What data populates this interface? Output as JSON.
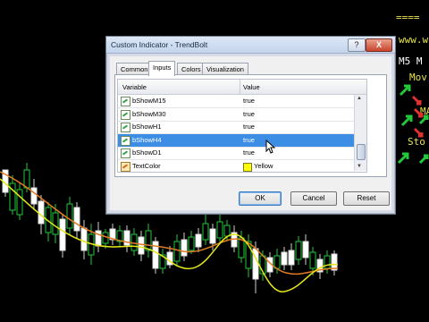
{
  "right_panel": {
    "top_dashes": "====",
    "url_fragment": "www.w",
    "m5_label": "M5 M",
    "row_labels": [
      "Mov",
      "MA",
      "Sto"
    ]
  },
  "dialog": {
    "title": "Custom Indicator - TrendBolt",
    "help_glyph": "?",
    "close_glyph": "X",
    "tabs": [
      "Common",
      "Inputs",
      "Colors",
      "Visualization"
    ],
    "active_tab": "Inputs",
    "columns": {
      "variable": "Variable",
      "value": "Value"
    },
    "rows": [
      {
        "variable": "bShowM15",
        "value": "true",
        "kind": "bool"
      },
      {
        "variable": "bShowM30",
        "value": "true",
        "kind": "bool"
      },
      {
        "variable": "bShowH1",
        "value": "true",
        "kind": "bool"
      },
      {
        "variable": "bShowH4",
        "value": "true",
        "kind": "bool",
        "selected": true
      },
      {
        "variable": "bShowD1",
        "value": "true",
        "kind": "bool"
      },
      {
        "variable": "TextColor",
        "value": "Yellow",
        "kind": "color",
        "swatch": "#ffff00"
      }
    ],
    "buttons": {
      "ok": "OK",
      "cancel": "Cancel",
      "reset": "Reset"
    }
  },
  "colors": {
    "candle_bull": "#ffffff",
    "candle_bear": "#22c83a",
    "ma_fast": "#e6e619",
    "ma_slow": "#e07a22",
    "selection": "#3c8ee4"
  }
}
